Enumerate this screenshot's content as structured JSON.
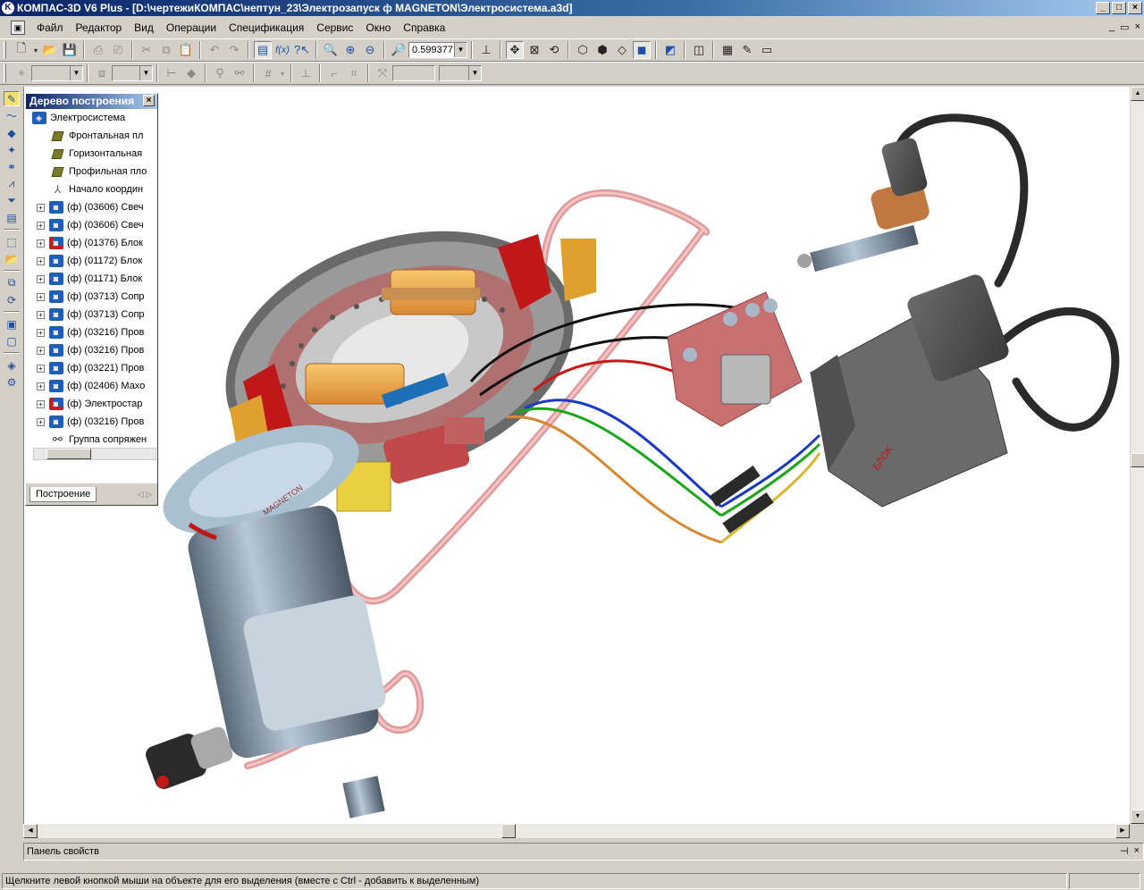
{
  "window": {
    "title": "КОМПАС-3D V6 Plus - [D:\\чертежиКОМПАС\\нептун_23\\Электрозапуск ф MAGNETON\\Электросистема.a3d]",
    "app_icon": "kompas-logo-icon",
    "controls": [
      "minimize",
      "maximize",
      "close"
    ]
  },
  "menu": {
    "items": [
      "Файл",
      "Редактор",
      "Вид",
      "Операции",
      "Спецификация",
      "Сервис",
      "Окно",
      "Справка"
    ]
  },
  "toolbar_main": {
    "zoom_value": "0.599377"
  },
  "tree_panel": {
    "title": "Дерево построения",
    "root": "Электросистема",
    "items": [
      {
        "label": "Фронтальная пл",
        "icon": "plane-icon",
        "expandable": false
      },
      {
        "label": "Горизонтальная",
        "icon": "plane-icon",
        "expandable": false
      },
      {
        "label": "Профильная пло",
        "icon": "plane-icon",
        "expandable": false
      },
      {
        "label": "Начало координ",
        "icon": "origin-icon",
        "expandable": false
      },
      {
        "label": "(ф) (03606) Свеч",
        "icon": "part-icon",
        "expandable": true
      },
      {
        "label": "(ф) (03606) Свеч",
        "icon": "part-icon",
        "expandable": true
      },
      {
        "label": "(ф) (01376) Блок",
        "icon": "part-icon-red",
        "expandable": true
      },
      {
        "label": "(ф) (01172) Блок",
        "icon": "part-icon",
        "expandable": true
      },
      {
        "label": "(ф) (01171) Блок",
        "icon": "part-icon",
        "expandable": true
      },
      {
        "label": "(ф) (03713) Сопр",
        "icon": "part-icon",
        "expandable": true
      },
      {
        "label": "(ф) (03713) Сопр",
        "icon": "part-icon",
        "expandable": true
      },
      {
        "label": "(ф) (03216) Пров",
        "icon": "part-icon",
        "expandable": true
      },
      {
        "label": "(ф) (03216) Пров",
        "icon": "part-icon",
        "expandable": true
      },
      {
        "label": "(ф) (03221) Пров",
        "icon": "part-icon",
        "expandable": true
      },
      {
        "label": "(ф) (02406) Махо",
        "icon": "part-icon",
        "expandable": true
      },
      {
        "label": "(ф) Электростар",
        "icon": "part-icon-red",
        "expandable": true
      },
      {
        "label": "(ф) (03216) Пров",
        "icon": "part-icon",
        "expandable": true
      },
      {
        "label": "Группа сопряжен",
        "icon": "constraint-group-icon",
        "expandable": false
      }
    ],
    "tab_label": "Построение"
  },
  "property_panel": {
    "label": "Панель свойств"
  },
  "status": {
    "hint": "Щелкните левой кнопкой мыши на объекте для его выделения (вместе с Ctrl - добавить к выделенным)"
  },
  "colors": {
    "title_start": "#0a246a",
    "title_end": "#a6caf0",
    "chrome": "#d4d0c8",
    "accent_blue": "#1d4fa8",
    "wire_pink": "#e09a9a",
    "part_red": "#c01818",
    "coil_orange": "#f0a848",
    "metal_grey": "#8a8a8a"
  }
}
